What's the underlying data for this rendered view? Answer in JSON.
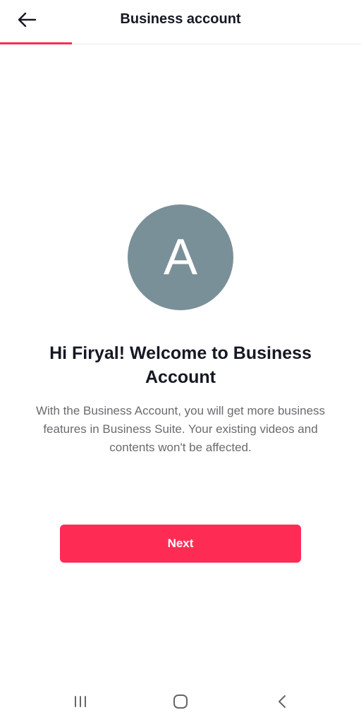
{
  "header": {
    "title": "Business account",
    "back_icon": "arrow-left-icon",
    "progress_fraction": 0.2
  },
  "avatar": {
    "letter": "A",
    "color": "#7a9099"
  },
  "welcome": {
    "title": "Hi Firyal! Welcome to Business Account",
    "description": "With the Business Account, you will get more business features in Business Suite. Your existing videos and contents won't be affected."
  },
  "next_button": {
    "label": "Next",
    "color": "#fe2c55"
  },
  "system_nav": {
    "recents_icon": "recent-apps-icon",
    "home_icon": "home-icon",
    "back_icon": "nav-back-icon"
  },
  "colors": {
    "accent": "#fe2c55",
    "text_primary": "#161823",
    "text_secondary": "#6b6b70"
  }
}
